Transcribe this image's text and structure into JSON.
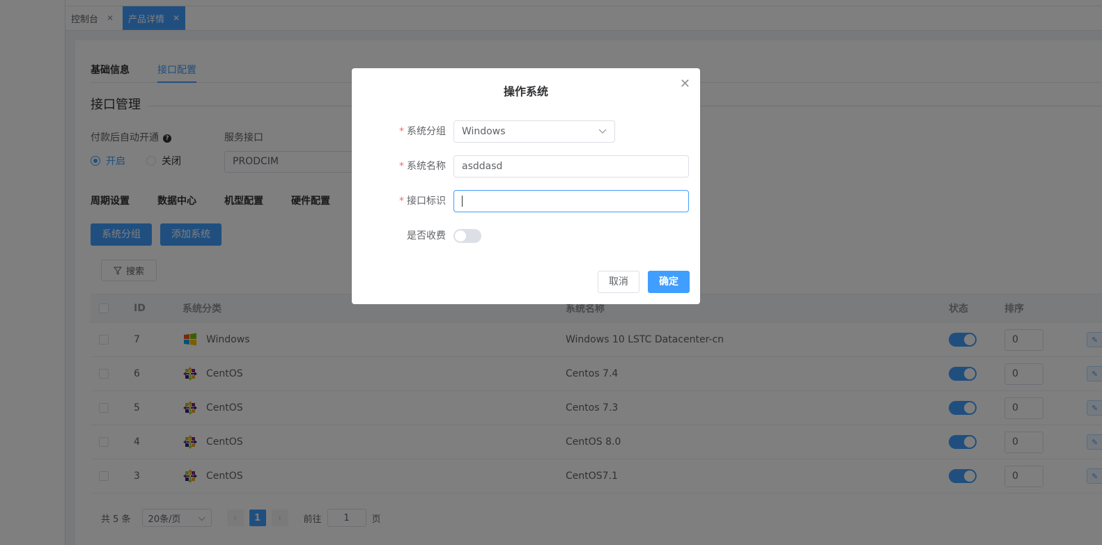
{
  "tabs": [
    {
      "label": "控制台",
      "active": false
    },
    {
      "label": "产品详情",
      "active": true
    }
  ],
  "subtabs": [
    "基础信息",
    "接口配置"
  ],
  "section_title": "接口管理",
  "auto_open": {
    "label": "付款后自动开通",
    "on": "开启",
    "off": "关闭",
    "selected": "开启"
  },
  "service": {
    "label": "服务接口",
    "value": "PRODCIM"
  },
  "config_tabs": [
    "周期设置",
    "数据中心",
    "机型配置",
    "硬件配置"
  ],
  "buttons": {
    "group": "系统分组",
    "add": "添加系统",
    "search": "搜索"
  },
  "table": {
    "headers": {
      "id": "ID",
      "category": "系统分类",
      "name": "系统名称",
      "status": "状态",
      "sort": "排序"
    },
    "rows": [
      {
        "id": "7",
        "category": "Windows",
        "name": "Windows 10 LSTC Datacenter-cn",
        "sort": "0",
        "icon": "windows-icon"
      },
      {
        "id": "6",
        "category": "CentOS",
        "name": "Centos 7.4",
        "sort": "0",
        "icon": "centos-icon"
      },
      {
        "id": "5",
        "category": "CentOS",
        "name": "Centos 7.3",
        "sort": "0",
        "icon": "centos-icon"
      },
      {
        "id": "4",
        "category": "CentOS",
        "name": "CentOS 8.0",
        "sort": "0",
        "icon": "centos-icon"
      },
      {
        "id": "3",
        "category": "CentOS",
        "name": "CentOS7.1",
        "sort": "0",
        "icon": "centos-icon"
      }
    ]
  },
  "pagination": {
    "total": "共 5 条",
    "page_size": "20条/页",
    "current": "1",
    "goto_label": "前往",
    "goto_value": "1",
    "page_unit": "页"
  },
  "dialog": {
    "title": "操作系统",
    "fields": {
      "group": {
        "label": "系统分组",
        "value": "Windows"
      },
      "name": {
        "label": "系统名称",
        "value": "asddasd"
      },
      "ident": {
        "label": "接口标识",
        "value": ""
      },
      "charge": {
        "label": "是否收费"
      }
    },
    "cancel": "取消",
    "ok": "确定"
  },
  "colors": {
    "primary": "#409eff",
    "required": "#f56c6c",
    "overlay": "rgba(0,0,0,0.5)"
  }
}
